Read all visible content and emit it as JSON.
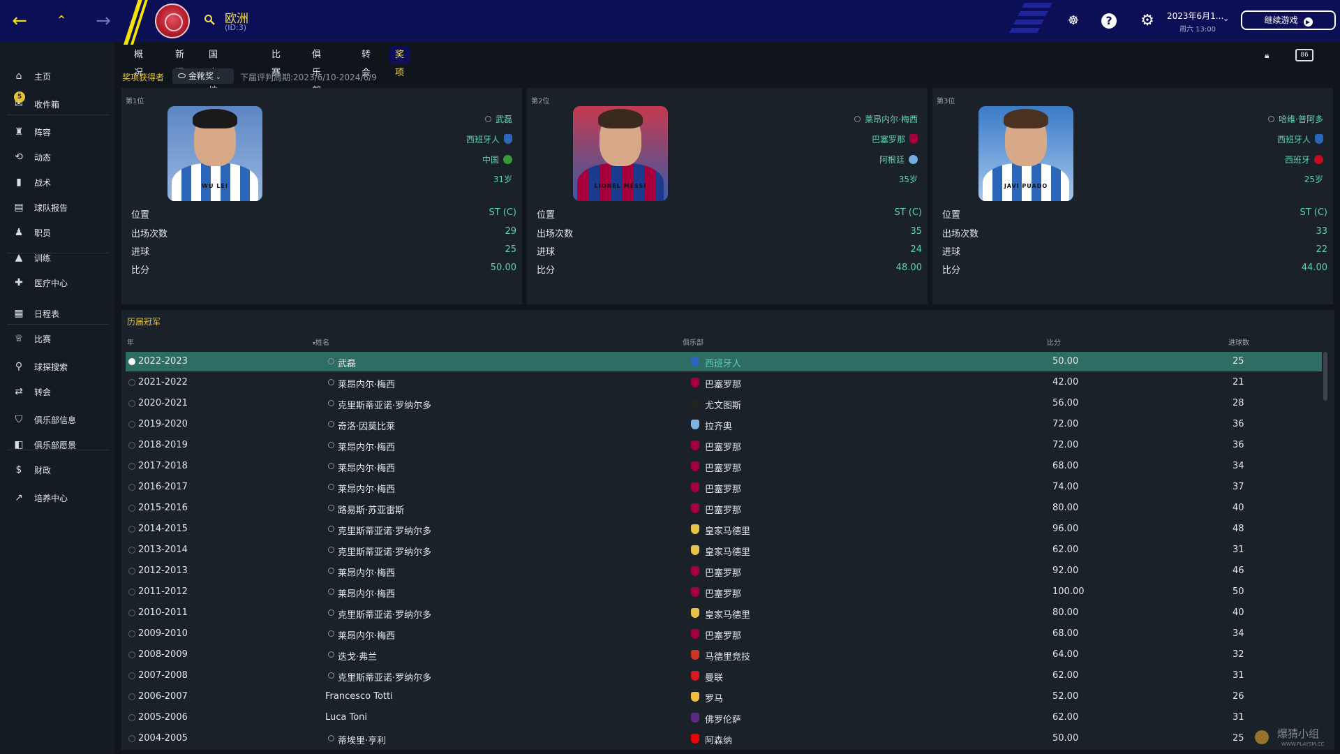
{
  "header": {
    "title": "欧洲",
    "subtitle": "(ID:3)",
    "date": "2023年6月1...",
    "day_time": "周六 13:00",
    "continue_label": "继续游戏"
  },
  "sidebar": {
    "inbox_badge": "5",
    "items": [
      {
        "label": "主页",
        "icon": "home-icon"
      },
      {
        "label": "收件箱",
        "icon": "inbox-icon"
      },
      {
        "label": "阵容",
        "icon": "shirt-icon"
      },
      {
        "label": "动态",
        "icon": "dynamics-icon"
      },
      {
        "label": "战术",
        "icon": "tactics-icon"
      },
      {
        "label": "球队报告",
        "icon": "report-icon"
      },
      {
        "label": "职员",
        "icon": "staff-icon"
      },
      {
        "label": "训练",
        "icon": "training-icon"
      },
      {
        "label": "医疗中心",
        "icon": "medical-icon"
      },
      {
        "label": "日程表",
        "icon": "calendar-icon"
      },
      {
        "label": "比赛",
        "icon": "trophy-icon"
      },
      {
        "label": "球探搜索",
        "icon": "search-icon"
      },
      {
        "label": "转会",
        "icon": "transfer-icon"
      },
      {
        "label": "俱乐部信息",
        "icon": "shield-icon"
      },
      {
        "label": "俱乐部愿景",
        "icon": "vision-icon"
      },
      {
        "label": "财政",
        "icon": "finance-icon"
      },
      {
        "label": "培养中心",
        "icon": "development-icon"
      }
    ]
  },
  "tabs": [
    "概况",
    "新闻",
    "国家/地区",
    "比赛",
    "俱乐部",
    "转会",
    "奖项"
  ],
  "awards": {
    "winners_label": "奖项获得者",
    "dropdown_value": "金靴奖",
    "period": "下届评判周期:2023/6/10-2024/6/9"
  },
  "podium": [
    {
      "rank": "第1位",
      "name": "武磊",
      "club": "西班牙人",
      "nation": "中国",
      "age": "31岁",
      "jersey": "WU LEI",
      "stats": [
        {
          "label": "位置",
          "value": "ST (C)"
        },
        {
          "label": "出场次数",
          "value": "29"
        },
        {
          "label": "进球",
          "value": "25"
        },
        {
          "label": "比分",
          "value": "50.00"
        }
      ]
    },
    {
      "rank": "第2位",
      "name": "莱昂内尔·梅西",
      "club": "巴塞罗那",
      "nation": "阿根廷",
      "age": "35岁",
      "jersey": "LIONEL MESSI",
      "stats": [
        {
          "label": "位置",
          "value": "ST (C)"
        },
        {
          "label": "出场次数",
          "value": "35"
        },
        {
          "label": "进球",
          "value": "24"
        },
        {
          "label": "比分",
          "value": "48.00"
        }
      ]
    },
    {
      "rank": "第3位",
      "name": "哈维·普阿多",
      "club": "西班牙人",
      "nation": "西班牙",
      "age": "25岁",
      "jersey": "JAVI PUADO",
      "stats": [
        {
          "label": "位置",
          "value": "ST (C)"
        },
        {
          "label": "出场次数",
          "value": "33"
        },
        {
          "label": "进球",
          "value": "22"
        },
        {
          "label": "比分",
          "value": "44.00"
        }
      ]
    }
  ],
  "history": {
    "title": "历届冠军",
    "headers": {
      "year": "年",
      "name": "姓名",
      "club": "俱乐部",
      "score": "比分",
      "goals": "进球数"
    },
    "rows": [
      {
        "year": "2022-2023",
        "name": "武磊",
        "club": "西班牙人",
        "score": "50.00",
        "goals": "25"
      },
      {
        "year": "2021-2022",
        "name": "莱昂内尔·梅西",
        "club": "巴塞罗那",
        "score": "42.00",
        "goals": "21"
      },
      {
        "year": "2020-2021",
        "name": "克里斯蒂亚诺·罗纳尔多",
        "club": "尤文图斯",
        "score": "56.00",
        "goals": "28"
      },
      {
        "year": "2019-2020",
        "name": "奇洛·因莫比莱",
        "club": "拉齐奥",
        "score": "72.00",
        "goals": "36"
      },
      {
        "year": "2018-2019",
        "name": "莱昂内尔·梅西",
        "club": "巴塞罗那",
        "score": "72.00",
        "goals": "36"
      },
      {
        "year": "2017-2018",
        "name": "莱昂内尔·梅西",
        "club": "巴塞罗那",
        "score": "68.00",
        "goals": "34"
      },
      {
        "year": "2016-2017",
        "name": "莱昂内尔·梅西",
        "club": "巴塞罗那",
        "score": "74.00",
        "goals": "37"
      },
      {
        "year": "2015-2016",
        "name": "路易斯·苏亚雷斯",
        "club": "巴塞罗那",
        "score": "80.00",
        "goals": "40"
      },
      {
        "year": "2014-2015",
        "name": "克里斯蒂亚诺·罗纳尔多",
        "club": "皇家马德里",
        "score": "96.00",
        "goals": "48"
      },
      {
        "year": "2013-2014",
        "name": "克里斯蒂亚诺·罗纳尔多",
        "club": "皇家马德里",
        "score": "62.00",
        "goals": "31"
      },
      {
        "year": "2012-2013",
        "name": "莱昂内尔·梅西",
        "club": "巴塞罗那",
        "score": "92.00",
        "goals": "46"
      },
      {
        "year": "2011-2012",
        "name": "莱昂内尔·梅西",
        "club": "巴塞罗那",
        "score": "100.00",
        "goals": "50"
      },
      {
        "year": "2010-2011",
        "name": "克里斯蒂亚诺·罗纳尔多",
        "club": "皇家马德里",
        "score": "80.00",
        "goals": "40"
      },
      {
        "year": "2009-2010",
        "name": "莱昂内尔·梅西",
        "club": "巴塞罗那",
        "score": "68.00",
        "goals": "34"
      },
      {
        "year": "2008-2009",
        "name": "迭戈·弗兰",
        "club": "马德里竞技",
        "score": "64.00",
        "goals": "32"
      },
      {
        "year": "2007-2008",
        "name": "克里斯蒂亚诺·罗纳尔多",
        "club": "曼联",
        "score": "62.00",
        "goals": "31"
      },
      {
        "year": "2006-2007",
        "name": "Francesco Totti",
        "club": "罗马",
        "score": "52.00",
        "goals": "26"
      },
      {
        "year": "2005-2006",
        "name": "Luca Toni",
        "club": "佛罗伦萨",
        "score": "62.00",
        "goals": "31"
      },
      {
        "year": "2004-2005",
        "name": "蒂埃里·亨利",
        "club": "阿森纳",
        "score": "50.00",
        "goals": "25"
      }
    ]
  },
  "watermark": {
    "text": "爆猜小组",
    "sub": "WWW.PLAYSM.CC"
  },
  "colors": {
    "accent": "#5fd1b7",
    "topbar": "#0c0e56",
    "highlight": "#f3e24a",
    "selected_row": "#2e6d63"
  }
}
